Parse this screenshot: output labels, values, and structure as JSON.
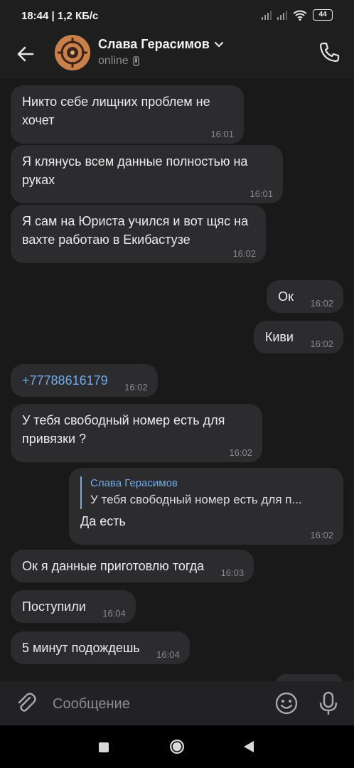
{
  "status_bar": {
    "time": "18:44",
    "speed": "1,2 КБ/с",
    "battery": "44"
  },
  "header": {
    "contact_name": "Слава Герасимов",
    "status": "online"
  },
  "messages": [
    {
      "dir": "in",
      "text": "Никто себе лищних проблем не хочет",
      "time": "16:01"
    },
    {
      "dir": "in",
      "text": "Я клянусь всем данные полностью на руках",
      "time": "16:01"
    },
    {
      "dir": "in",
      "text": "Я сам на Юриста учился и вот щяс на вахте работаю в Екибастузе",
      "time": "16:02"
    },
    {
      "dir": "out",
      "text": "Ок",
      "time": "16:02"
    },
    {
      "dir": "out",
      "text": "Киви",
      "time": "16:02"
    },
    {
      "dir": "in",
      "text": "+77788616179",
      "time": "16:02"
    },
    {
      "dir": "in",
      "text": "У тебя свободный номер есть для привязки ?",
      "time": "16:02"
    },
    {
      "dir": "out",
      "reply_name": "Слава Герасимов",
      "reply_text": "У тебя свободный номер есть для п...",
      "text": "Да есть",
      "time": "16:02"
    },
    {
      "dir": "in",
      "text": "Ок я данные приготовлю тогда",
      "time": "16:03"
    },
    {
      "dir": "in",
      "text": "Поступили",
      "time": "16:04"
    },
    {
      "dir": "in",
      "text": "5 минут подождешь",
      "time": "16:04"
    }
  ],
  "composer": {
    "placeholder": "Сообщение"
  },
  "colors": {
    "background": "#19191a",
    "bubble": "#2c2c2e",
    "accent": "#71aaeb"
  },
  "icons": [
    "back-arrow-icon",
    "phone-icon",
    "attach-icon",
    "emoji-icon",
    "mic-icon",
    "wifi-icon",
    "signal-icon",
    "battery-icon"
  ]
}
